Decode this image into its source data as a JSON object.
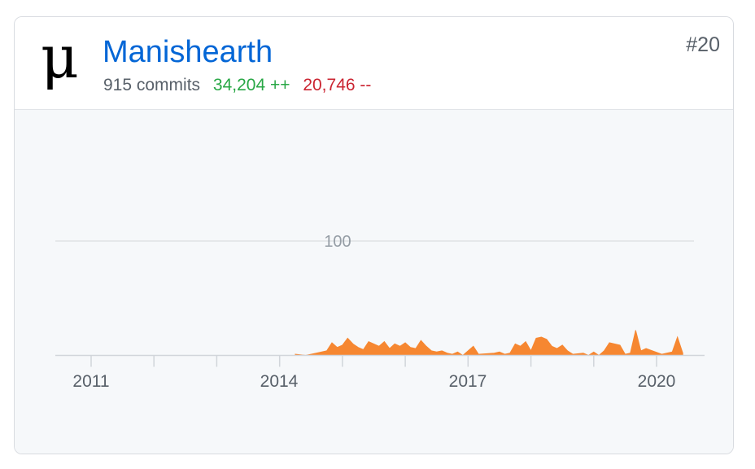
{
  "contributor": {
    "username": "Manishearth",
    "avatar_icon": "mu-glyph-avatar",
    "avatar_glyph": "μ",
    "rank": "#20",
    "commits": "915 commits",
    "additions": "34,204 ++",
    "deletions": "20,746 --"
  },
  "colors": {
    "link": "#0366d6",
    "additions": "#28a745",
    "deletions": "#cb2431",
    "area_fill": "#f68731"
  },
  "chart_data": {
    "type": "area",
    "title": "",
    "xlabel": "",
    "ylabel": "",
    "ylim": [
      0,
      100
    ],
    "yticks": [
      100
    ],
    "ytick_labels": [
      "100"
    ],
    "xtick_labels": [
      "2011",
      "2014",
      "2017",
      "2020"
    ],
    "x": [
      "2014-04",
      "2014-06",
      "2014-08",
      "2014-10",
      "2014-11",
      "2014-12",
      "2015-01",
      "2015-02",
      "2015-03",
      "2015-04",
      "2015-05",
      "2015-06",
      "2015-07",
      "2015-08",
      "2015-09",
      "2015-10",
      "2015-11",
      "2015-12",
      "2016-01",
      "2016-02",
      "2016-03",
      "2016-04",
      "2016-05",
      "2016-06",
      "2016-07",
      "2016-08",
      "2016-09",
      "2016-10",
      "2016-11",
      "2016-12",
      "2017-02",
      "2017-03",
      "2017-06",
      "2017-07",
      "2017-08",
      "2017-09",
      "2017-10",
      "2017-11",
      "2017-12",
      "2018-01",
      "2018-02",
      "2018-03",
      "2018-04",
      "2018-05",
      "2018-06",
      "2018-07",
      "2018-08",
      "2018-09",
      "2018-11",
      "2018-12",
      "2019-01",
      "2019-02",
      "2019-03",
      "2019-04",
      "2019-06",
      "2019-07",
      "2019-08",
      "2019-09",
      "2019-10",
      "2019-11",
      "2020-02",
      "2020-04",
      "2020-05",
      "2020-06"
    ],
    "series": [
      {
        "values": [
          1,
          0,
          2,
          4,
          11,
          7,
          9,
          15,
          10,
          7,
          5,
          12,
          10,
          8,
          12,
          6,
          10,
          8,
          11,
          7,
          6,
          13,
          8,
          4,
          3,
          4,
          2,
          1,
          3,
          0,
          8,
          1,
          2,
          3,
          1,
          2,
          10,
          8,
          12,
          4,
          15,
          16,
          14,
          8,
          6,
          9,
          4,
          1,
          2,
          0,
          3,
          0,
          4,
          11,
          9,
          1,
          2,
          22,
          4,
          6,
          1,
          3,
          16,
          2
        ]
      }
    ]
  }
}
